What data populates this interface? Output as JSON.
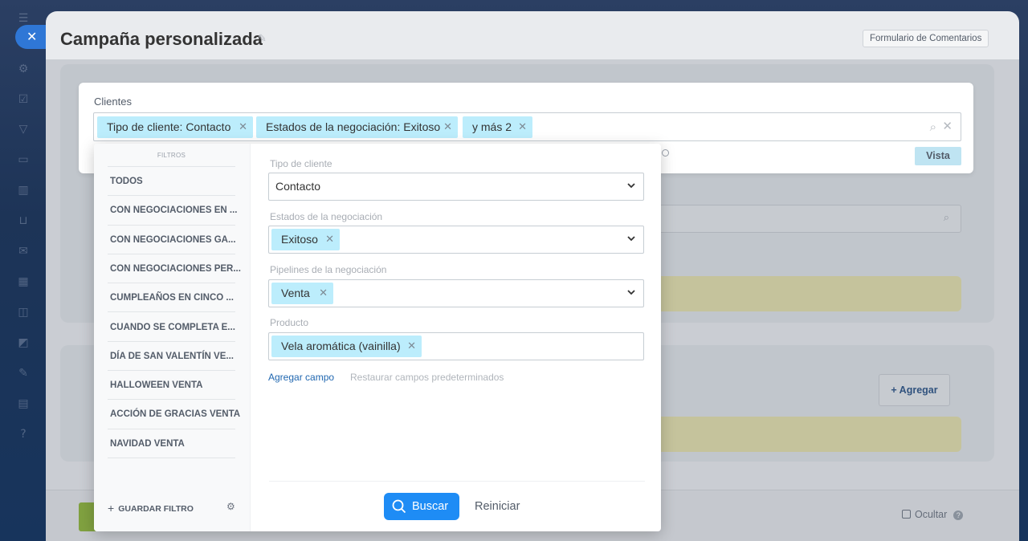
{
  "page": {
    "title": "Campaña personalizada",
    "feedback_label": "Formulario de Comentarios"
  },
  "clients": {
    "label": "Clientes",
    "chips": [
      "Tipo de cliente: Contacto",
      "Estados de la negociación: Exitoso",
      "y más 2"
    ],
    "view_label": "Vista"
  },
  "filter_panel": {
    "heading": "FILTROS",
    "presets": [
      "TODOS",
      "CON NEGOCIACIONES EN ...",
      "CON NEGOCIACIONES GA...",
      "CON NEGOCIACIONES PER...",
      "CUMPLEAÑOS EN CINCO ...",
      "CUANDO SE COMPLETA E...",
      "DÍA DE SAN VALENTÍN VE...",
      "HALLOWEEN VENTA",
      "ACCIÓN DE GRACIAS VENTA",
      "NAVIDAD VENTA"
    ],
    "save_filter": "GUARDAR FILTRO",
    "fields": {
      "client_type": {
        "label": "Tipo de cliente",
        "value": "Contacto"
      },
      "deal_status": {
        "label": "Estados de la negociación",
        "value": "Exitoso"
      },
      "deal_pipeline": {
        "label": "Pipelines de la negociación",
        "value": "Venta"
      },
      "product": {
        "label": "Producto",
        "value": "Vela aromática (vainilla)"
      }
    },
    "add_field": "Agregar campo",
    "restore_fields": "Restaurar campos predeterminados",
    "search_button": "Buscar",
    "reset_button": "Reiniciar"
  },
  "background": {
    "add_button": "+ Agregar",
    "hide_label": "Ocultar"
  },
  "colors": {
    "chip": "#bcedfc",
    "primary": "#1e8cf5",
    "link": "#2067b0"
  }
}
